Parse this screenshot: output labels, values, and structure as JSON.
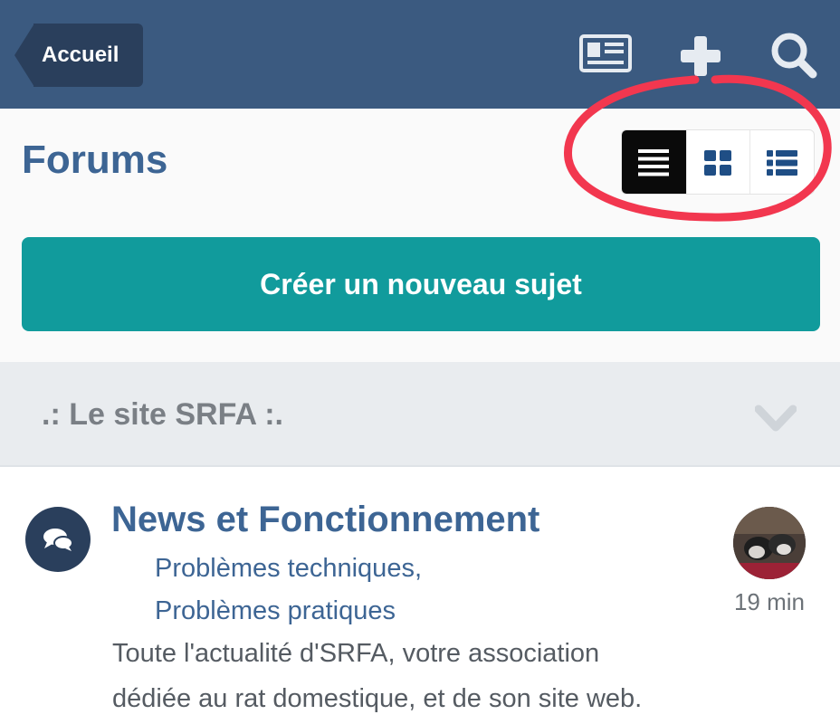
{
  "header": {
    "back_label": "Accueil",
    "icons": [
      "newspaper-icon",
      "plus-icon",
      "search-icon"
    ]
  },
  "page": {
    "title": "Forums",
    "views": [
      "table-view",
      "grid-view",
      "list-view"
    ],
    "active_view": "table-view",
    "create_label": "Créer un nouveau sujet"
  },
  "category": {
    "title": ".: Le site SRFA :."
  },
  "forum": {
    "title": "News et Fonctionnement",
    "sublinks": [
      "Problèmes techniques,",
      "Problèmes pratiques"
    ],
    "description_lines": [
      "Toute l'actualité d'SRFA, votre association",
      "dédiée au rat domestique, et de son site web."
    ],
    "last_post_time": "19 min"
  },
  "colors": {
    "header_bg": "#3b5a80",
    "accent_teal": "#119b9c",
    "title_blue": "#3d6594",
    "highlight_red": "#f2374f"
  }
}
